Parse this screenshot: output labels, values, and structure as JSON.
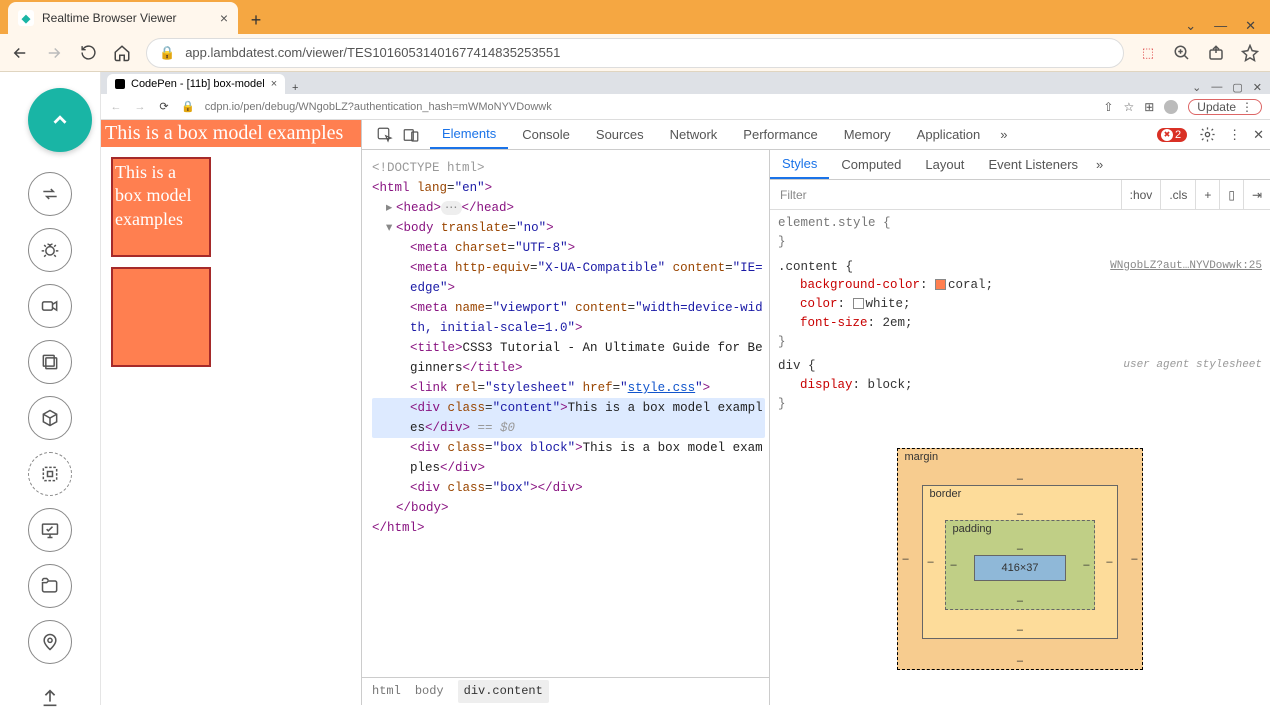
{
  "outer": {
    "tab_title": "Realtime Browser Viewer",
    "url": "app.lambdatest.com/viewer/TES10160531401677414835253551"
  },
  "inner": {
    "tab_title": "CodePen - [11b] box-model",
    "url": "cdpn.io/pen/debug/WNgobLZ?authentication_hash=mWMoNYVDowwk",
    "update_label": "Update"
  },
  "page": {
    "content_text": "This is a box model examples",
    "box_block_text": "This is a box model examples"
  },
  "devtools": {
    "tabs": [
      "Elements",
      "Console",
      "Sources",
      "Network",
      "Performance",
      "Memory",
      "Application"
    ],
    "error_count": "2",
    "styles_tabs": [
      "Styles",
      "Computed",
      "Layout",
      "Event Listeners"
    ],
    "filter_placeholder": "Filter",
    "chips": {
      "hov": ":hov",
      "cls": ".cls"
    },
    "breadcrumb": [
      "html",
      "body",
      "div.content"
    ],
    "boxmodel": {
      "margin_label": "margin",
      "border_label": "border",
      "padding_label": "padding",
      "content_dims": "416×37"
    }
  },
  "dom": {
    "doctype": "<!DOCTYPE html>",
    "html_open": "<html lang=\"en\">",
    "head": "<head>…</head>",
    "body_open": "<body translate=\"no\">",
    "meta1": "<meta charset=\"UTF-8\">",
    "meta2": "<meta http-equiv=\"X-UA-Compatible\" content=\"IE=edge\">",
    "meta3": "<meta name=\"viewport\" content=\"width=device-width, initial-scale=1.0\">",
    "title": "<title>CSS3 Tutorial - An Ultimate Guide for Beginners</title>",
    "link": {
      "pre": "<link rel=\"stylesheet\" href=\"",
      "href": "style.css",
      "post": "\">"
    },
    "div_content": "<div class=\"content\">This is a box model examples</div>",
    "sel_suffix": " == $0",
    "div_box_block": "<div class=\"box block\">This is a box model examples</div>",
    "div_box": "<div class=\"box\"></div>",
    "body_close": "</body>",
    "html_close": "</html>"
  },
  "rules": {
    "elstyle_sel": "element.style {",
    "elstyle_close": "}",
    "content_sel": ".content {",
    "content_src": "WNgobLZ?aut…NYVDowwk:25",
    "content_bg": {
      "name": "background-color",
      "val": "coral"
    },
    "content_color": {
      "name": "color",
      "val": "white"
    },
    "content_fs": {
      "name": "font-size",
      "val": "2em"
    },
    "content_close": "}",
    "div_sel": "div {",
    "div_src": "user agent stylesheet",
    "div_disp": {
      "name": "display",
      "val": "block"
    },
    "div_close": "}"
  }
}
